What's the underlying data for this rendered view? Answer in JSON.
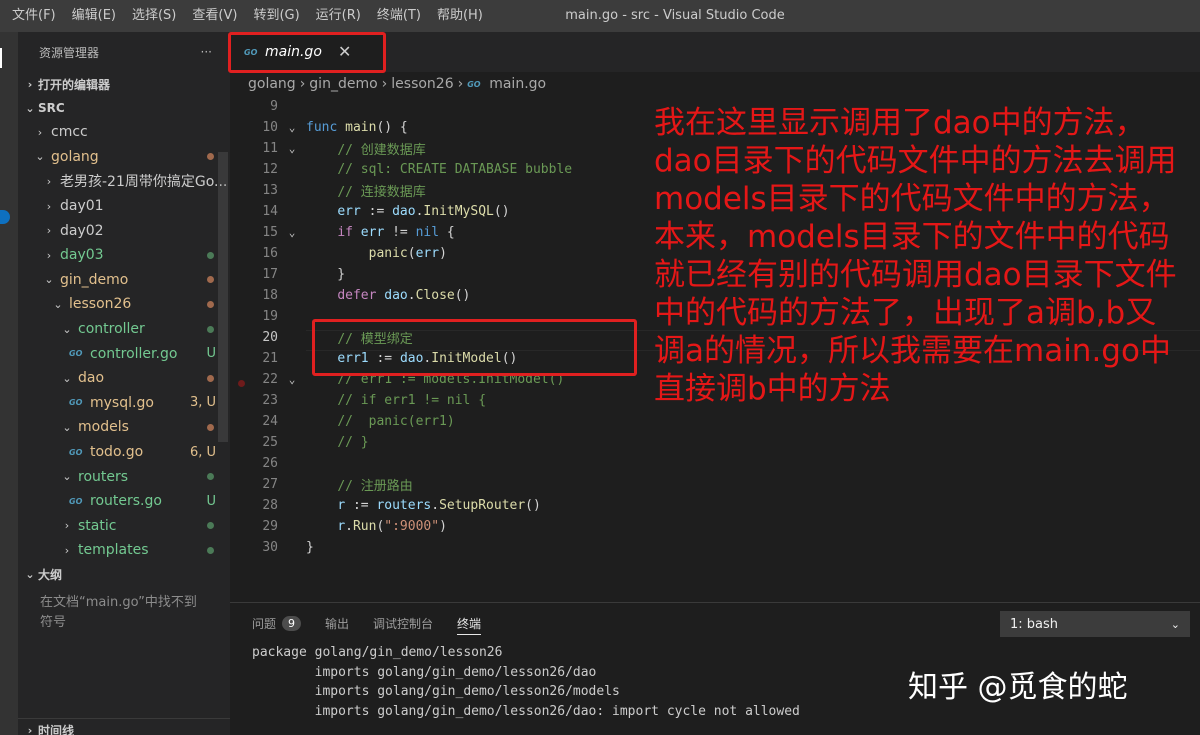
{
  "menu": [
    "文件(F)",
    "编辑(E)",
    "选择(S)",
    "查看(V)",
    "转到(G)",
    "运行(R)",
    "终端(T)",
    "帮助(H)"
  ],
  "window_title": "main.go - src - Visual Studio Code",
  "sidebar": {
    "title": "资源管理器",
    "more": "···",
    "open_editors": "打开的编辑器",
    "root": "SRC",
    "items": [
      {
        "label": "cmcc",
        "indent": 1,
        "chev": "›",
        "color": "#cccccc",
        "dot": "",
        "badge": ""
      },
      {
        "label": "golang",
        "indent": 1,
        "chev": "⌄",
        "color": "#e2c08d",
        "dot": "#a0694d",
        "badge": ""
      },
      {
        "label": "老男孩-21周带你搞定Go...",
        "indent": 2,
        "chev": "›",
        "color": "#cccccc",
        "dot": "",
        "badge": ""
      },
      {
        "label": "day01",
        "indent": 2,
        "chev": "›",
        "color": "#cccccc",
        "dot": "",
        "badge": ""
      },
      {
        "label": "day02",
        "indent": 2,
        "chev": "›",
        "color": "#cccccc",
        "dot": "",
        "badge": ""
      },
      {
        "label": "day03",
        "indent": 2,
        "chev": "›",
        "color": "#73c991",
        "dot": "#4b7a57",
        "badge": ""
      },
      {
        "label": "gin_demo",
        "indent": 2,
        "chev": "⌄",
        "color": "#e2c08d",
        "dot": "#a0694d",
        "badge": ""
      },
      {
        "label": "lesson26",
        "indent": 3,
        "chev": "⌄",
        "color": "#e2c08d",
        "dot": "#a0694d",
        "badge": ""
      },
      {
        "label": "controller",
        "indent": 4,
        "chev": "⌄",
        "color": "#73c991",
        "dot": "#4b7a57",
        "badge": ""
      },
      {
        "label": "controller.go",
        "indent": 5,
        "chev": "",
        "go": true,
        "color": "#73c991",
        "dot": "",
        "badge": "U",
        "badgeColor": "#73c991"
      },
      {
        "label": "dao",
        "indent": 4,
        "chev": "⌄",
        "color": "#e2c08d",
        "dot": "#a0694d",
        "badge": ""
      },
      {
        "label": "mysql.go",
        "indent": 5,
        "chev": "",
        "go": true,
        "color": "#e2c08d",
        "dot": "",
        "badge": "3, U",
        "badgeColor": "#e2c08d"
      },
      {
        "label": "models",
        "indent": 4,
        "chev": "⌄",
        "color": "#e2c08d",
        "dot": "#a0694d",
        "badge": ""
      },
      {
        "label": "todo.go",
        "indent": 5,
        "chev": "",
        "go": true,
        "color": "#e2c08d",
        "dot": "",
        "badge": "6, U",
        "badgeColor": "#e2c08d"
      },
      {
        "label": "routers",
        "indent": 4,
        "chev": "⌄",
        "color": "#73c991",
        "dot": "#4b7a57",
        "badge": ""
      },
      {
        "label": "routers.go",
        "indent": 5,
        "chev": "",
        "go": true,
        "color": "#73c991",
        "dot": "",
        "badge": "U",
        "badgeColor": "#73c991"
      },
      {
        "label": "static",
        "indent": 4,
        "chev": "›",
        "color": "#73c991",
        "dot": "#4b7a57",
        "badge": ""
      },
      {
        "label": "templates",
        "indent": 4,
        "chev": "›",
        "color": "#73c991",
        "dot": "#4b7a57",
        "badge": ""
      }
    ],
    "outline": "大纲",
    "outline_msg": "在文档“main.go”中找不到符号",
    "timeline": "时间线"
  },
  "tab": {
    "icon": "GO",
    "label": "main.go",
    "close": "✕"
  },
  "breadcrumb": [
    "golang",
    "gin_demo",
    "lesson26",
    "main.go"
  ],
  "code": [
    {
      "n": "9",
      "fold": "",
      "html": ""
    },
    {
      "n": "10",
      "fold": "⌄",
      "html": "<span class='kw'>func</span> <span class='fn'>main</span>() {"
    },
    {
      "n": "11",
      "fold": "⌄",
      "html": "    <span class='cm'>// 创建数据库</span>"
    },
    {
      "n": "12",
      "fold": "",
      "html": "    <span class='cm'>// sql: CREATE DATABASE bubble</span>"
    },
    {
      "n": "13",
      "fold": "",
      "html": "    <span class='cm'>// 连接数据库</span>"
    },
    {
      "n": "14",
      "fold": "",
      "html": "    <span class='var'>err</span> := <span class='var'>dao</span>.<span class='fn'>InitMySQL</span>()"
    },
    {
      "n": "15",
      "fold": "⌄",
      "html": "    <span class='ctl'>if</span> <span class='var'>err</span> != <span class='kw'>nil</span> {"
    },
    {
      "n": "16",
      "fold": "",
      "html": "        <span class='fn'>panic</span>(<span class='var'>err</span>)"
    },
    {
      "n": "17",
      "fold": "",
      "html": "    }"
    },
    {
      "n": "18",
      "fold": "",
      "html": "    <span class='ctl'>defer</span> <span class='var'>dao</span>.<span class='fn'>Close</span>()"
    },
    {
      "n": "19",
      "fold": "",
      "html": ""
    },
    {
      "n": "20",
      "fold": "",
      "html": "    <span class='cm'>// 模型绑定</span>",
      "cur": true
    },
    {
      "n": "21",
      "fold": "",
      "html": "    <span class='var'>err1</span> := <span class='var'>dao</span>.<span class='fn'>InitModel</span>()"
    },
    {
      "n": "22",
      "fold": "⌄",
      "html": "    <span class='cm'>// err1 := models.InitModel()</span>"
    },
    {
      "n": "23",
      "fold": "",
      "html": "    <span class='cm'>// if err1 != nil {</span>"
    },
    {
      "n": "24",
      "fold": "",
      "html": "    <span class='cm'>//  panic(err1)</span>"
    },
    {
      "n": "25",
      "fold": "",
      "html": "    <span class='cm'>// }</span>"
    },
    {
      "n": "26",
      "fold": "",
      "html": ""
    },
    {
      "n": "27",
      "fold": "",
      "html": "    <span class='cm'>// 注册路由</span>"
    },
    {
      "n": "28",
      "fold": "",
      "html": "    <span class='var'>r</span> := <span class='var'>routers</span>.<span class='fn'>SetupRouter</span>()"
    },
    {
      "n": "29",
      "fold": "",
      "html": "    <span class='var'>r</span>.<span class='fn'>Run</span>(<span class='str'>\":9000\"</span>)"
    },
    {
      "n": "30",
      "fold": "",
      "html": "}"
    }
  ],
  "annotation": "我在这里显示调用了dao中的方法，dao目录下的代码文件中的方法去调用models目录下的代码文件中的方法，本来，models目录下的文件中的代码就已经有别的代码调用dao目录下文件中的代码的方法了，出现了a调b,b又调a的情况，所以我需要在main.go中直接调b中的方法",
  "panel": {
    "tabs": [
      "问题",
      "输出",
      "调试控制台",
      "终端"
    ],
    "problems_count": "9",
    "terminal_select": "1: bash",
    "terminal_lines": [
      "package golang/gin_demo/lesson26",
      "        imports golang/gin_demo/lesson26/dao",
      "        imports golang/gin_demo/lesson26/models",
      "        imports golang/gin_demo/lesson26/dao: import cycle not allowed"
    ]
  },
  "watermark": "知乎 @觅食的蛇",
  "colors": {
    "annotation": "#e51717",
    "highlight_box": "#e02020",
    "modified": "#e2c08d",
    "untracked": "#73c991"
  }
}
